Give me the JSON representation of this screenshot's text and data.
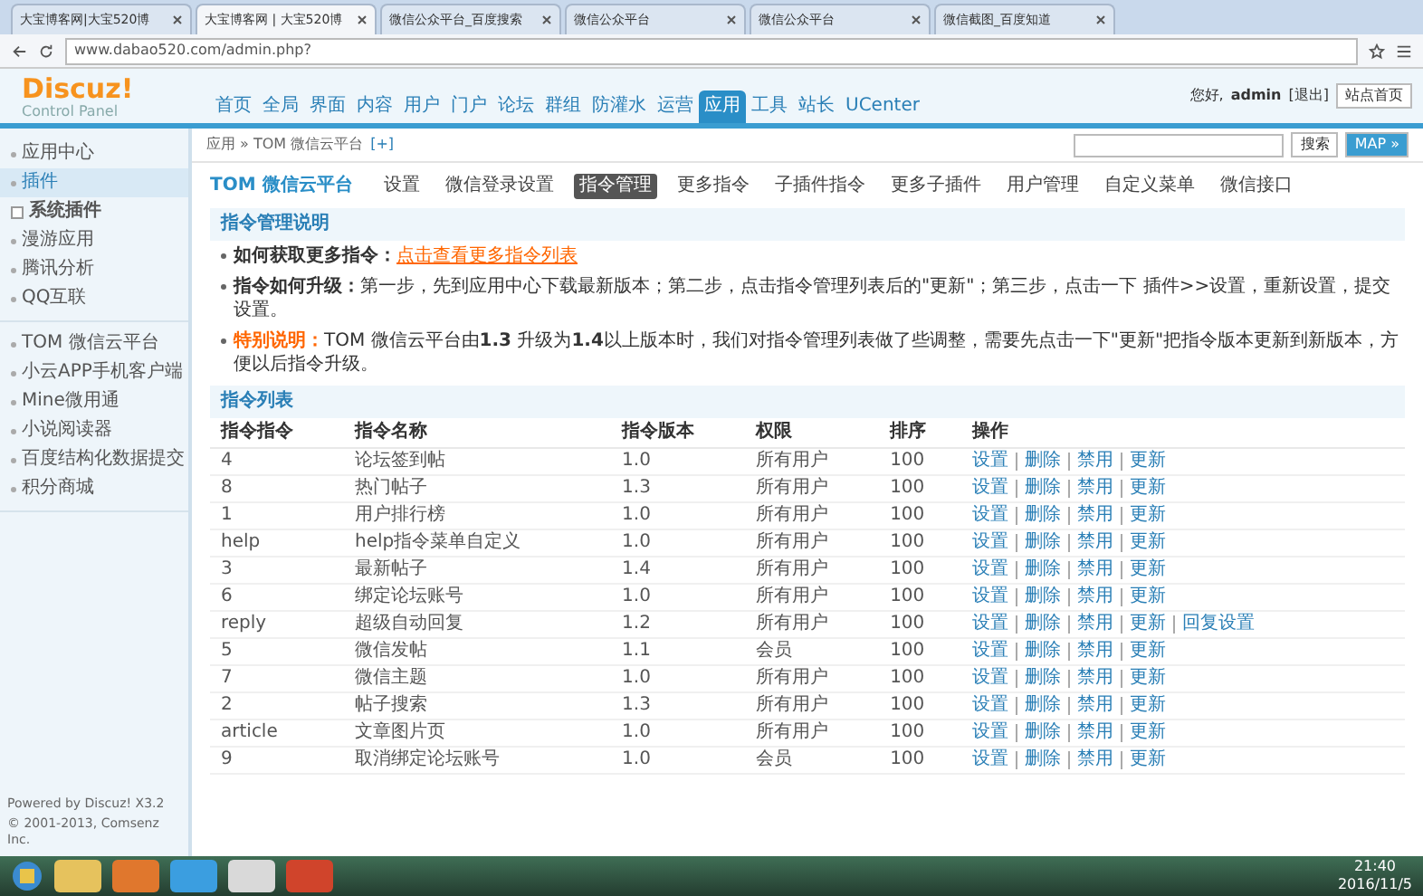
{
  "browser": {
    "tabs": [
      {
        "title": "大宝博客网|大宝520博",
        "selected": false
      },
      {
        "title": "大宝博客网 | 大宝520博",
        "selected": true
      },
      {
        "title": "微信公众平台_百度搜索",
        "selected": false
      },
      {
        "title": "微信公众平台",
        "selected": false
      },
      {
        "title": "微信公众平台",
        "selected": false
      },
      {
        "title": "微信截图_百度知道",
        "selected": false
      }
    ],
    "address": "www.dabao520.com/admin.php?"
  },
  "header": {
    "logo": "Discuz!",
    "subtitle": "Control Panel",
    "nav": [
      {
        "label": "首页",
        "selected": false
      },
      {
        "label": "全局",
        "selected": false
      },
      {
        "label": "界面",
        "selected": false
      },
      {
        "label": "内容",
        "selected": false
      },
      {
        "label": "用户",
        "selected": false
      },
      {
        "label": "门户",
        "selected": false
      },
      {
        "label": "论坛",
        "selected": false
      },
      {
        "label": "群组",
        "selected": false
      },
      {
        "label": "防灌水",
        "selected": false
      },
      {
        "label": "运营",
        "selected": false
      },
      {
        "label": "应用",
        "selected": true
      },
      {
        "label": "工具",
        "selected": false
      },
      {
        "label": "站长",
        "selected": false
      },
      {
        "label": "UCenter",
        "selected": false
      }
    ],
    "greeting": "您好,",
    "user": "admin",
    "logout": "[退出]",
    "home_button": "站点首页"
  },
  "breadcrumb": {
    "path": "应用 » TOM 微信云平台",
    "add": "[+]",
    "search_button": "搜索",
    "map_button": "MAP »"
  },
  "sidebar": {
    "groups": [
      [
        {
          "label": "应用中心",
          "kind": "link",
          "selected": false
        },
        {
          "label": "插件",
          "kind": "link",
          "selected": true
        },
        {
          "label": "系统插件",
          "kind": "group",
          "selected": false
        },
        {
          "label": "漫游应用",
          "kind": "link",
          "selected": false
        },
        {
          "label": "腾讯分析",
          "kind": "link",
          "selected": false
        },
        {
          "label": "QQ互联",
          "kind": "link",
          "selected": false
        }
      ],
      [
        {
          "label": "TOM 微信云平台",
          "kind": "link",
          "selected": false
        },
        {
          "label": "小云APP手机客户端",
          "kind": "link",
          "selected": false
        },
        {
          "label": "Mine微用通",
          "kind": "link",
          "selected": false
        },
        {
          "label": "小说阅读器",
          "kind": "link",
          "selected": false
        },
        {
          "label": "百度结构化数据提交",
          "kind": "link",
          "selected": false
        },
        {
          "label": "积分商城",
          "kind": "link",
          "selected": false
        }
      ]
    ],
    "powered": "Powered by Discuz! X3.2",
    "copyright": "© 2001-2013, Comsenz Inc."
  },
  "plugin": {
    "title": "TOM 微信云平台",
    "tabs": [
      {
        "label": "设置",
        "selected": false
      },
      {
        "label": "微信登录设置",
        "selected": false
      },
      {
        "label": "指令管理",
        "selected": true
      },
      {
        "label": "更多指令",
        "selected": false
      },
      {
        "label": "子插件指令",
        "selected": false
      },
      {
        "label": "更多子插件",
        "selected": false
      },
      {
        "label": "用户管理",
        "selected": false
      },
      {
        "label": "自定义菜单",
        "selected": false
      },
      {
        "label": "微信接口",
        "selected": false
      }
    ]
  },
  "notes": {
    "title": "指令管理说明",
    "items": [
      {
        "kind": "link",
        "label": "如何获取更多指令：",
        "text": "点击查看更多指令列表"
      },
      {
        "kind": "text",
        "label": "指令如何升级：",
        "text": "第一步，先到应用中心下载最新版本；第二步，点击指令管理列表后的\"更新\"；第三步，点击一下 插件>>设置，重新设置，提交设置。"
      },
      {
        "kind": "warning",
        "label": "特别说明：",
        "text": "TOM 微信云平台由**1.3** 升级为**1.4**以上版本时，我们对指令管理列表做了些调整，需要先点击一下\"更新\"把指令版本更新到新版本，方便以后指令升级。"
      }
    ]
  },
  "table": {
    "title": "指令列表",
    "columns": [
      "指令指令",
      "指令名称",
      "指令版本",
      "权限",
      "排序",
      "操作"
    ],
    "rows": [
      {
        "cells": [
          "4",
          "论坛签到帖",
          "1.0",
          "所有用户",
          "100"
        ],
        "actions": [
          "设置",
          "删除",
          "禁用",
          "更新"
        ]
      },
      {
        "cells": [
          "8",
          "热门帖子",
          "1.3",
          "所有用户",
          "100"
        ],
        "actions": [
          "设置",
          "删除",
          "禁用",
          "更新"
        ]
      },
      {
        "cells": [
          "1",
          "用户排行榜",
          "1.0",
          "所有用户",
          "100"
        ],
        "actions": [
          "设置",
          "删除",
          "禁用",
          "更新"
        ]
      },
      {
        "cells": [
          "help",
          "help指令菜单自定义",
          "1.0",
          "所有用户",
          "100"
        ],
        "actions": [
          "设置",
          "删除",
          "禁用",
          "更新"
        ]
      },
      {
        "cells": [
          "3",
          "最新帖子",
          "1.4",
          "所有用户",
          "100"
        ],
        "actions": [
          "设置",
          "删除",
          "禁用",
          "更新"
        ]
      },
      {
        "cells": [
          "6",
          "绑定论坛账号",
          "1.0",
          "所有用户",
          "100"
        ],
        "actions": [
          "设置",
          "删除",
          "禁用",
          "更新"
        ]
      },
      {
        "cells": [
          "reply",
          "超级自动回复",
          "1.2",
          "所有用户",
          "100"
        ],
        "actions": [
          "设置",
          "删除",
          "禁用",
          "更新",
          "回复设置"
        ]
      },
      {
        "cells": [
          "5",
          "微信发帖",
          "1.1",
          "会员",
          "100"
        ],
        "actions": [
          "设置",
          "删除",
          "禁用",
          "更新"
        ]
      },
      {
        "cells": [
          "7",
          "微信主题",
          "1.0",
          "所有用户",
          "100"
        ],
        "actions": [
          "设置",
          "删除",
          "禁用",
          "更新"
        ]
      },
      {
        "cells": [
          "2",
          "帖子搜索",
          "1.3",
          "所有用户",
          "100"
        ],
        "actions": [
          "设置",
          "删除",
          "禁用",
          "更新"
        ]
      },
      {
        "cells": [
          "article",
          "文章图片页",
          "1.0",
          "所有用户",
          "100"
        ],
        "actions": [
          "设置",
          "删除",
          "禁用",
          "更新"
        ]
      },
      {
        "cells": [
          "9",
          "取消绑定论坛账号",
          "1.0",
          "会员",
          "100"
        ],
        "actions": [
          "设置",
          "删除",
          "禁用",
          "更新"
        ]
      }
    ]
  },
  "taskbar": {
    "time": "21:40",
    "date": "2016/11/5"
  }
}
